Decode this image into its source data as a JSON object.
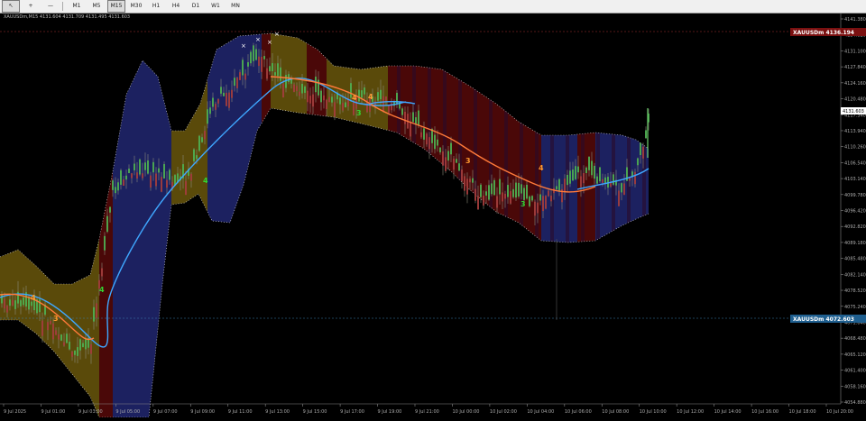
{
  "toolbar": {
    "tools": [
      {
        "name": "pointer-tool",
        "glyph": "↖"
      },
      {
        "name": "crosshair-tool",
        "glyph": "+"
      },
      {
        "name": "hline-tool",
        "glyph": "—"
      }
    ],
    "timeframes": [
      "M1",
      "M5",
      "M15",
      "M30",
      "H1",
      "H4",
      "D1",
      "W1",
      "MN"
    ],
    "active_timeframe": "M15"
  },
  "chart": {
    "instrument_line": "XAUUSDm,M15  4131.604 4131.709 4131.495 4131.603",
    "price_axis_labels": [
      "4141.380",
      "4134.820",
      "4131.100",
      "4127.840",
      "4124.160",
      "4120.480",
      "4117.340",
      "4113.940",
      "4110.260",
      "4106.540",
      "4103.140",
      "4099.780",
      "4096.420",
      "4092.820",
      "4089.180",
      "4085.480",
      "4082.140",
      "4078.520",
      "4075.240",
      "4071.840",
      "4068.480",
      "4065.120",
      "4061.400",
      "4058.160",
      "4054.880"
    ],
    "price_badges": {
      "upper": {
        "label": "XAUUSDm 4136.194",
        "value": "4136.194",
        "color": "#7a1010"
      },
      "current": {
        "label": "4131.603",
        "color": "#ffffff"
      },
      "lower": {
        "label": "XAUUSDm 4072.603",
        "value": "4072.603",
        "color": "#1f5f8f"
      }
    },
    "time_axis_labels": [
      "9 Jul 2025",
      "9 Jul 01:00",
      "9 Jul 03:00",
      "9 Jul 05:00",
      "9 Jul 07:00",
      "9 Jul 09:00",
      "9 Jul 11:00",
      "9 Jul 13:00",
      "9 Jul 15:00",
      "9 Jul 17:00",
      "9 Jul 19:00",
      "9 Jul 21:00",
      "10 Jul 00:00",
      "10 Jul 02:00",
      "10 Jul 04:00",
      "10 Jul 06:00",
      "10 Jul 08:00",
      "10 Jul 10:00",
      "10 Jul 12:00",
      "10 Jul 14:00",
      "10 Jul 16:00",
      "10 Jul 18:00",
      "10 Jul 20:00"
    ],
    "wave_labels": [
      "4",
      "3",
      "4",
      "4",
      "4",
      "3",
      "4",
      "3",
      "3",
      "4"
    ],
    "markers": [
      "×",
      "×",
      "×",
      "×"
    ],
    "colors": {
      "background": "#000000",
      "band_olive": "#5a4a0a",
      "band_navy": "#1c2160",
      "band_maroon": "#4a0808",
      "ma_blue": "#3fa7ff",
      "ma_orange": "#ff7a3a",
      "candle": "#8a8a7a",
      "bull": "#4caf50",
      "bear": "#a33b3b"
    }
  }
}
